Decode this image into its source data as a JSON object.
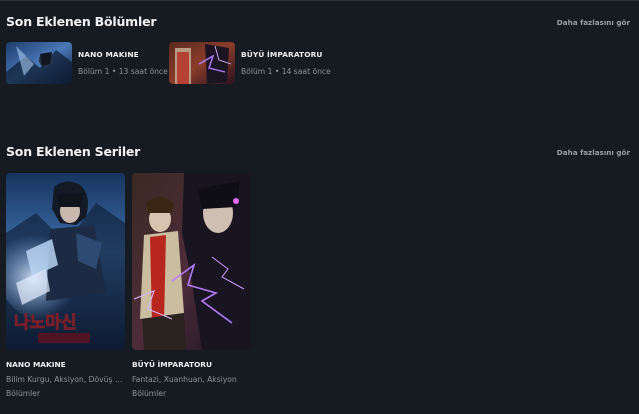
{
  "colors": {
    "background": "#161a21",
    "text_primary": "#f0f0f2",
    "text_secondary": "#8d939b"
  },
  "recent_episodes": {
    "title": "Son Eklenen Bölümler",
    "see_more": "Daha fazlasını gör",
    "items": [
      {
        "series": "NANO MAKINE",
        "meta": "Bölüm 1 • 13 saat önce"
      },
      {
        "series": "BÜYÜ İMPARATORU",
        "meta": "Bölüm 1 • 14 saat önce"
      }
    ]
  },
  "recent_series": {
    "title": "Son Eklenen Seriler",
    "see_more": "Daha fazlasını gör",
    "items": [
      {
        "title": "NANO MAKINE",
        "genres": "Bilim Kurgu, Aksiyon, Dövüş Sanatları",
        "link": "Bölümler",
        "cover_logo": "나노마신"
      },
      {
        "title": "BÜYÜ İMPARATORU",
        "genres": "Fantazi, Xuanhuan, Aksiyon",
        "link": "Bölümler"
      }
    ]
  }
}
